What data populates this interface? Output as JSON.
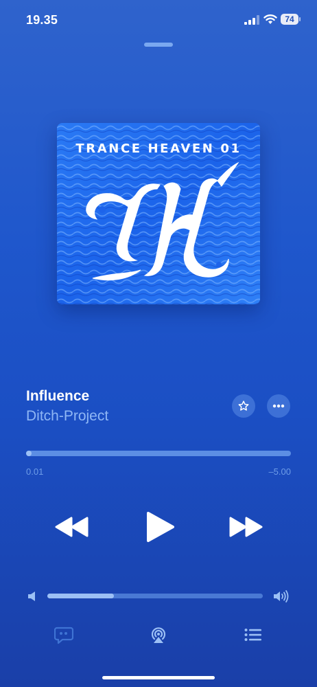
{
  "status_bar": {
    "time": "19.35",
    "battery_level": "74"
  },
  "album": {
    "title_text": "TRANCE HEAVEN 01",
    "monogram": "TH"
  },
  "track": {
    "title": "Influence",
    "artist": "Ditch-Project"
  },
  "playback": {
    "elapsed": "0.01",
    "remaining": "–5.00",
    "progress_fraction": 0.01
  },
  "volume": {
    "level_fraction": 0.31
  },
  "icons": {
    "favorite": "star-icon",
    "more": "ellipsis-icon",
    "rewind": "rewind-icon",
    "play": "play-icon",
    "forward": "fast-forward-icon",
    "volume_low": "speaker-icon",
    "volume_high": "speaker-wave-icon",
    "lyrics": "lyrics-icon",
    "airplay": "airplay-icon",
    "queue": "queue-list-icon"
  },
  "colors": {
    "accent_text": "#8fb7f5",
    "progress_fill": "#9cc0f5",
    "album_bg": "#1e6ef0"
  }
}
